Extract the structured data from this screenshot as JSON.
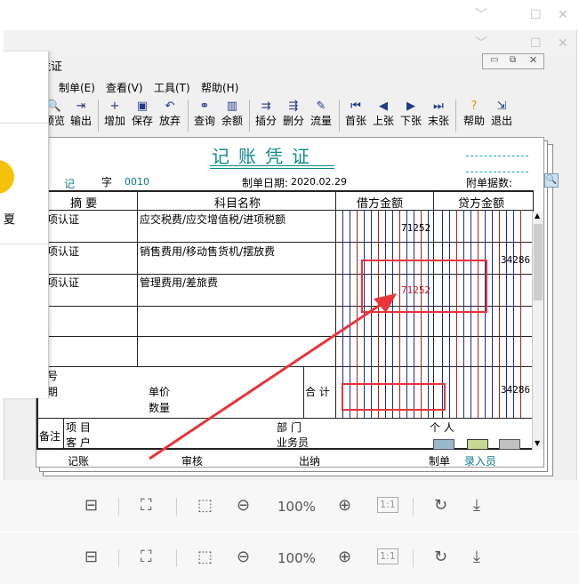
{
  "outer_window": {
    "controls": [
      "minimize-icon",
      "maximize-icon",
      "close-icon"
    ]
  },
  "inner_window": {
    "title": "凭证"
  },
  "menu": [
    "制单(E)",
    "查看(V)",
    "工具(T)",
    "帮助(H)"
  ],
  "toolbar": [
    {
      "label": "预览",
      "icon": "preview-icon"
    },
    {
      "label": "输出",
      "icon": "export-icon"
    },
    {
      "label": "增加",
      "icon": "add-icon"
    },
    {
      "label": "保存",
      "icon": "save-icon"
    },
    {
      "label": "放弃",
      "icon": "undo-icon"
    },
    {
      "label": "查询",
      "icon": "binoculars-icon"
    },
    {
      "label": "余额",
      "icon": "balance-chart-icon"
    },
    {
      "label": "插分",
      "icon": "insert-row-icon"
    },
    {
      "label": "删分",
      "icon": "delete-row-icon"
    },
    {
      "label": "流量",
      "icon": "flow-icon"
    },
    {
      "label": "首张",
      "icon": "first-icon"
    },
    {
      "label": "上张",
      "icon": "prev-icon"
    },
    {
      "label": "下张",
      "icon": "next-icon"
    },
    {
      "label": "末张",
      "icon": "last-icon"
    },
    {
      "label": "帮助",
      "icon": "help-icon"
    },
    {
      "label": "退出",
      "icon": "exit-icon"
    }
  ],
  "voucher": {
    "title": "记账凭证",
    "type_char": "记",
    "zi": "字",
    "number": "0010",
    "date_label": "制单日期:",
    "date": "2020.02.29",
    "attachments_label": "附单据数:",
    "headers": {
      "summary": "摘 要",
      "account": "科目名称",
      "debit": "借方金额",
      "credit": "贷方金额"
    },
    "rows": [
      {
        "summary": "项认证",
        "account": "应交税费/应交增值税/进项税额",
        "debit": "71252",
        "credit": ""
      },
      {
        "summary": "项认证",
        "account": "销售费用/移动售货机/摆放费",
        "debit": "",
        "credit": "34286"
      },
      {
        "summary": "项认证",
        "account": "管理费用/差旅费",
        "debit": "71252",
        "credit": ""
      },
      {
        "summary": "",
        "account": "",
        "debit": "",
        "credit": ""
      },
      {
        "summary": "",
        "account": "",
        "debit": "",
        "credit": ""
      }
    ],
    "footer": {
      "number_label": "号",
      "date_label": "期",
      "unit_price": "单价",
      "quantity": "数量",
      "total_label": "合 计",
      "total_credit": "34286",
      "remark": "备注",
      "item": "项 目",
      "customer": "客 户",
      "department": "部 门",
      "person": "个 人",
      "salesman": "业务员"
    },
    "signatures": {
      "bookkeeper": "记账",
      "reviewer": "审核",
      "cashier": "出纳",
      "maker": "制单",
      "maker_name": "录入员"
    }
  },
  "left_panel": {
    "text": "夏"
  },
  "viewer_toolbar": {
    "zoom": "100%",
    "actual_size": "1:1"
  },
  "colors": {
    "annotation_red": "#e8343a",
    "title_teal": "#0f8a8a",
    "grid_blue": "#1a2a9a",
    "grid_red": "#b02020"
  }
}
